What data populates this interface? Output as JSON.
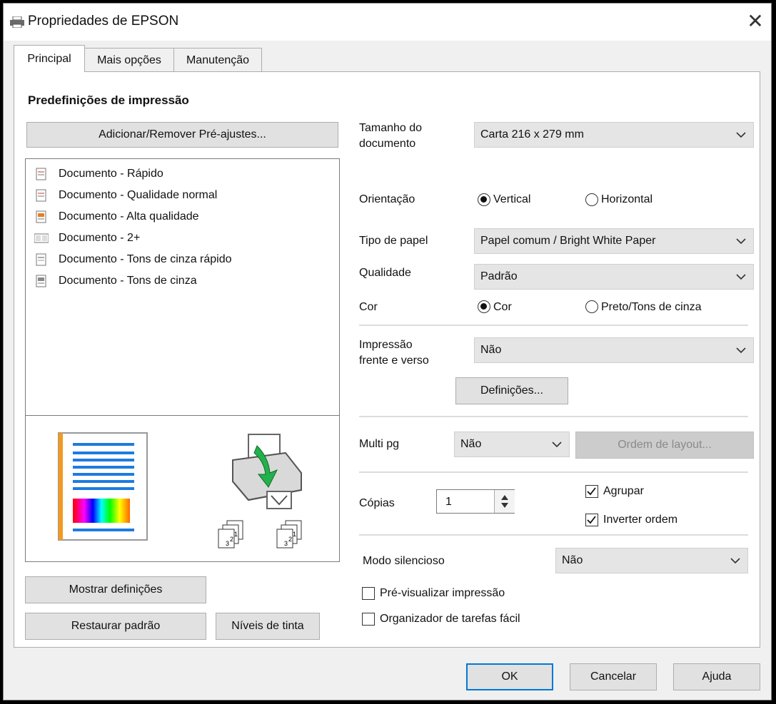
{
  "window": {
    "title": "Propriedades de EPSON"
  },
  "tabs": [
    {
      "label": "Principal",
      "active": true
    },
    {
      "label": "Mais opções",
      "active": false
    },
    {
      "label": "Manutenção",
      "active": false
    }
  ],
  "presets": {
    "heading": "Predefinições de impressão",
    "add_remove_label": "Adicionar/Remover Pré-ajustes...",
    "items": [
      "Documento - Rápido",
      "Documento - Qualidade normal",
      "Documento - Alta qualidade",
      "Documento - 2+",
      "Documento - Tons de cinza rápido",
      "Documento - Tons de cinza"
    ]
  },
  "settings": {
    "document_size": {
      "label_line1": "Tamanho do",
      "label_line2": "documento",
      "value": "Carta 216 x 279 mm"
    },
    "orientation": {
      "label": "Orientação",
      "option_vertical": "Vertical",
      "option_horizontal": "Horizontal",
      "selected": "Vertical"
    },
    "paper_type": {
      "label": "Tipo de papel",
      "value": "Papel comum / Bright White Paper"
    },
    "quality": {
      "label": "Qualidade",
      "value": "Padrão"
    },
    "color": {
      "label": "Cor",
      "option_color": "Cor",
      "option_bw": "Preto/Tons de cinza",
      "selected": "Cor"
    },
    "duplex": {
      "label_line1": "Impressão",
      "label_line2": "frente e verso",
      "value": "Não",
      "settings_button": "Definições..."
    },
    "multipage": {
      "label": "Multi pg",
      "value": "Não",
      "layout_order_button": "Ordem de layout..."
    },
    "copies": {
      "label": "Cópias",
      "value": "1",
      "collate_label": "Agrupar",
      "collate_checked": true,
      "reverse_label": "Inverter ordem",
      "reverse_checked": true
    },
    "quiet_mode": {
      "label": "Modo silencioso",
      "value": "Não"
    },
    "print_preview": {
      "label": "Pré-visualizar impressão",
      "checked": false
    },
    "job_arranger": {
      "label": "Organizador de tarefas fácil",
      "checked": false
    }
  },
  "left_buttons": {
    "show_settings": "Mostrar definições",
    "restore_defaults": "Restaurar padrão",
    "ink_levels": "Níveis de tinta"
  },
  "footer": {
    "ok": "OK",
    "cancel": "Cancelar",
    "help": "Ajuda"
  },
  "colors": {
    "selection_blue": "#0078d7",
    "preview_blue": "#1e7be0",
    "preview_orange": "#f39a1e",
    "arrow_green": "#22b14c"
  }
}
